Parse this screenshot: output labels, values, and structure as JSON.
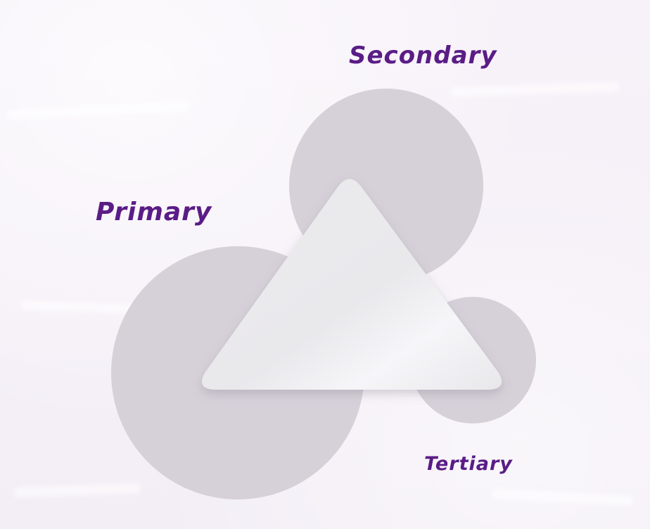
{
  "diagram": {
    "nodes": [
      {
        "id": "primary",
        "label": "Primary"
      },
      {
        "id": "secondary",
        "label": "Secondary"
      },
      {
        "id": "tertiary",
        "label": "Tertiary"
      }
    ],
    "colors": {
      "background": "#f6f1f8",
      "circle_fill": "#d6d0d9",
      "triangle_fill": "#ededee",
      "label_text": "#5a1c86"
    }
  }
}
